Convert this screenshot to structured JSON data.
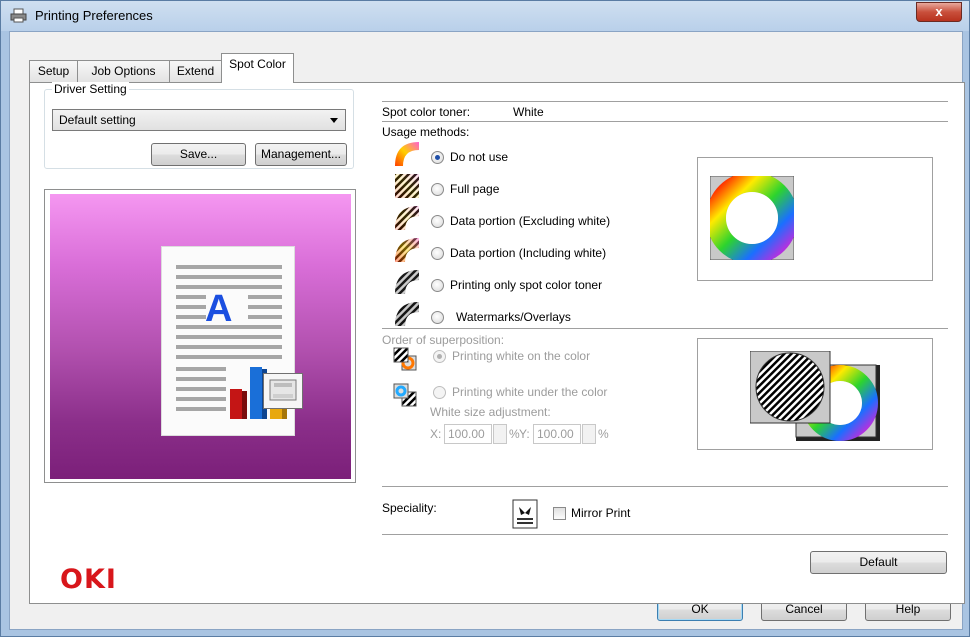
{
  "window": {
    "title": "Printing Preferences",
    "close_label": "x"
  },
  "tabs": [
    {
      "label": "Setup"
    },
    {
      "label": "Job Options"
    },
    {
      "label": "Extend"
    },
    {
      "label": "Spot Color"
    }
  ],
  "driver_setting": {
    "legend": "Driver Setting",
    "selected": "Default setting",
    "save_label": "Save...",
    "management_label": "Management..."
  },
  "spot_color": {
    "toner_label": "Spot color toner:",
    "toner_value": "White",
    "usage_label": "Usage methods:",
    "usage_options": [
      {
        "label": "Do not use",
        "selected": true
      },
      {
        "label": "Full page",
        "selected": false
      },
      {
        "label": "Data portion (Excluding white)",
        "selected": false
      },
      {
        "label": "Data portion (Including white)",
        "selected": false
      },
      {
        "label": "Printing only spot color toner",
        "selected": false
      },
      {
        "label": "Watermarks/Overlays",
        "selected": false
      }
    ],
    "order_label": "Order of superposition:",
    "order_options": [
      {
        "label": "Printing white on the color",
        "selected": true
      },
      {
        "label": "Printing white under the color",
        "selected": false
      }
    ],
    "white_size_label": "White size adjustment:",
    "x_label": "X:",
    "x_value": "100.00",
    "y_label": "Y:",
    "y_value": "100.00",
    "percent": "%",
    "speciality_label": "Speciality:",
    "mirror_label": "Mirror Print",
    "mirror_checked": false
  },
  "brand": {
    "logo": "OKI",
    "color": "#d8161b"
  },
  "buttons": {
    "default": "Default",
    "ok": "OK",
    "cancel": "Cancel",
    "help": "Help"
  },
  "colors": {
    "accent": "#1f4fa8",
    "preview_top": "#f597f1",
    "preview_bottom": "#7b1f79"
  }
}
